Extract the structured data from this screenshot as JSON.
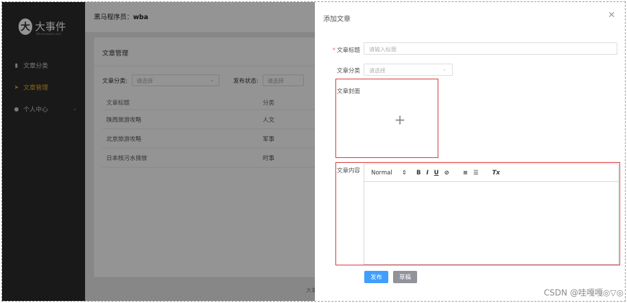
{
  "sidebar": {
    "logo_mark": "大",
    "logo_text": "大事件",
    "logo_sub": "Bounceopera.com",
    "items": [
      {
        "icon": "bar-chart-icon",
        "glyph": "▮",
        "label": "文章分类"
      },
      {
        "icon": "send-icon",
        "glyph": "➤",
        "label": "文章管理"
      },
      {
        "icon": "user-icon",
        "glyph": "●",
        "label": "个人中心",
        "chevron": "⌄"
      }
    ]
  },
  "topbar": {
    "user_prefix": "黑马程序员：",
    "user_name": "wba"
  },
  "card": {
    "title": "文章管理",
    "filter": {
      "category_label": "文章分类:",
      "category_placeholder": "请选择",
      "status_label": "发布状态:",
      "status_placeholder": "请选择"
    },
    "table": {
      "headers": [
        "文章标题",
        "分类"
      ],
      "rows": [
        [
          "陕西旅游攻略",
          "人文"
        ],
        [
          "北京旅游攻略",
          "军事"
        ],
        [
          "日本核污水排放",
          "时事"
        ]
      ]
    },
    "footer_text": "大事"
  },
  "drawer": {
    "title": "添加文章",
    "close_glyph": "✕",
    "title_label": "文章标题",
    "required_mark": "*",
    "title_placeholder": "请输入标题",
    "category_label": "文章分类",
    "category_placeholder": "请选择",
    "cover_label": "文章封面",
    "content_label": "文章内容",
    "toolbar": {
      "size": "Normal",
      "bold": "B",
      "italic": "I",
      "underline": "U",
      "link": "🔗",
      "ol": "⒈",
      "ul": "☰",
      "clean": "Tx"
    },
    "publish_label": "发布",
    "draft_label": "草稿"
  },
  "watermark": "CSDN @哇嘎嘎◎▽◎",
  "colors": {
    "primary": "#409eff",
    "active": "#f2a93b",
    "highlight": "#d83a3a",
    "sidebar_bg": "#2b2b2b"
  }
}
